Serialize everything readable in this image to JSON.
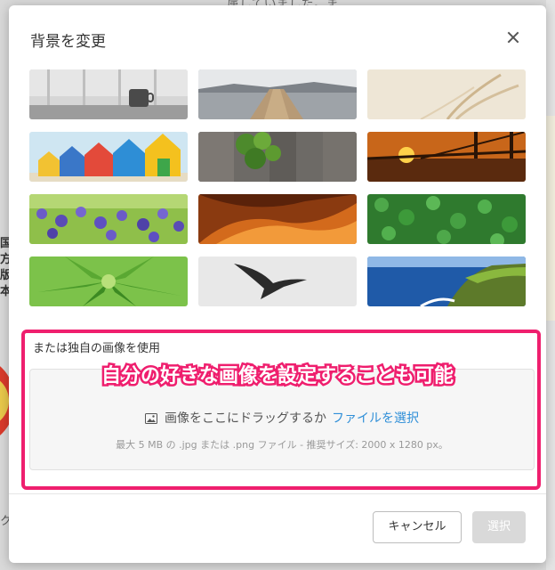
{
  "background": {
    "top_text": "属していました。ま",
    "left_chars": [
      "国",
      "方",
      "版",
      "本"
    ],
    "left_bottom": "ク"
  },
  "modal": {
    "title": "背景を変更",
    "close_icon": "close-icon",
    "thumbnails": [
      {
        "name": "thumb-coffee-window",
        "subject": "coffee mug by window"
      },
      {
        "name": "thumb-lake-pier",
        "subject": "lake pier"
      },
      {
        "name": "thumb-grass-soft",
        "subject": "soft grass"
      },
      {
        "name": "thumb-beach-huts",
        "subject": "colorful beach huts"
      },
      {
        "name": "thumb-ivy-wood",
        "subject": "ivy on wood"
      },
      {
        "name": "thumb-bridge-sunset",
        "subject": "bridge at sunset"
      },
      {
        "name": "thumb-lavender",
        "subject": "lavender field"
      },
      {
        "name": "thumb-canyon",
        "subject": "orange canyon"
      },
      {
        "name": "thumb-clover",
        "subject": "clover leaves"
      },
      {
        "name": "thumb-succulent",
        "subject": "green succulent"
      },
      {
        "name": "thumb-bird",
        "subject": "flying bird"
      },
      {
        "name": "thumb-coast",
        "subject": "ocean coast"
      }
    ],
    "upload": {
      "label": "または独自の画像を使用",
      "drop_text": "画像をここにドラッグするか",
      "drop_link": "ファイルを選択",
      "hint": "最大 5 MB の .jpg または .png ファイル - 推奨サイズ: 2000 x 1280 px。",
      "icon": "image-icon"
    },
    "annotation": "自分の好きな画像を設定することも可能",
    "footer": {
      "cancel_label": "キャンセル",
      "select_label": "選択"
    }
  }
}
